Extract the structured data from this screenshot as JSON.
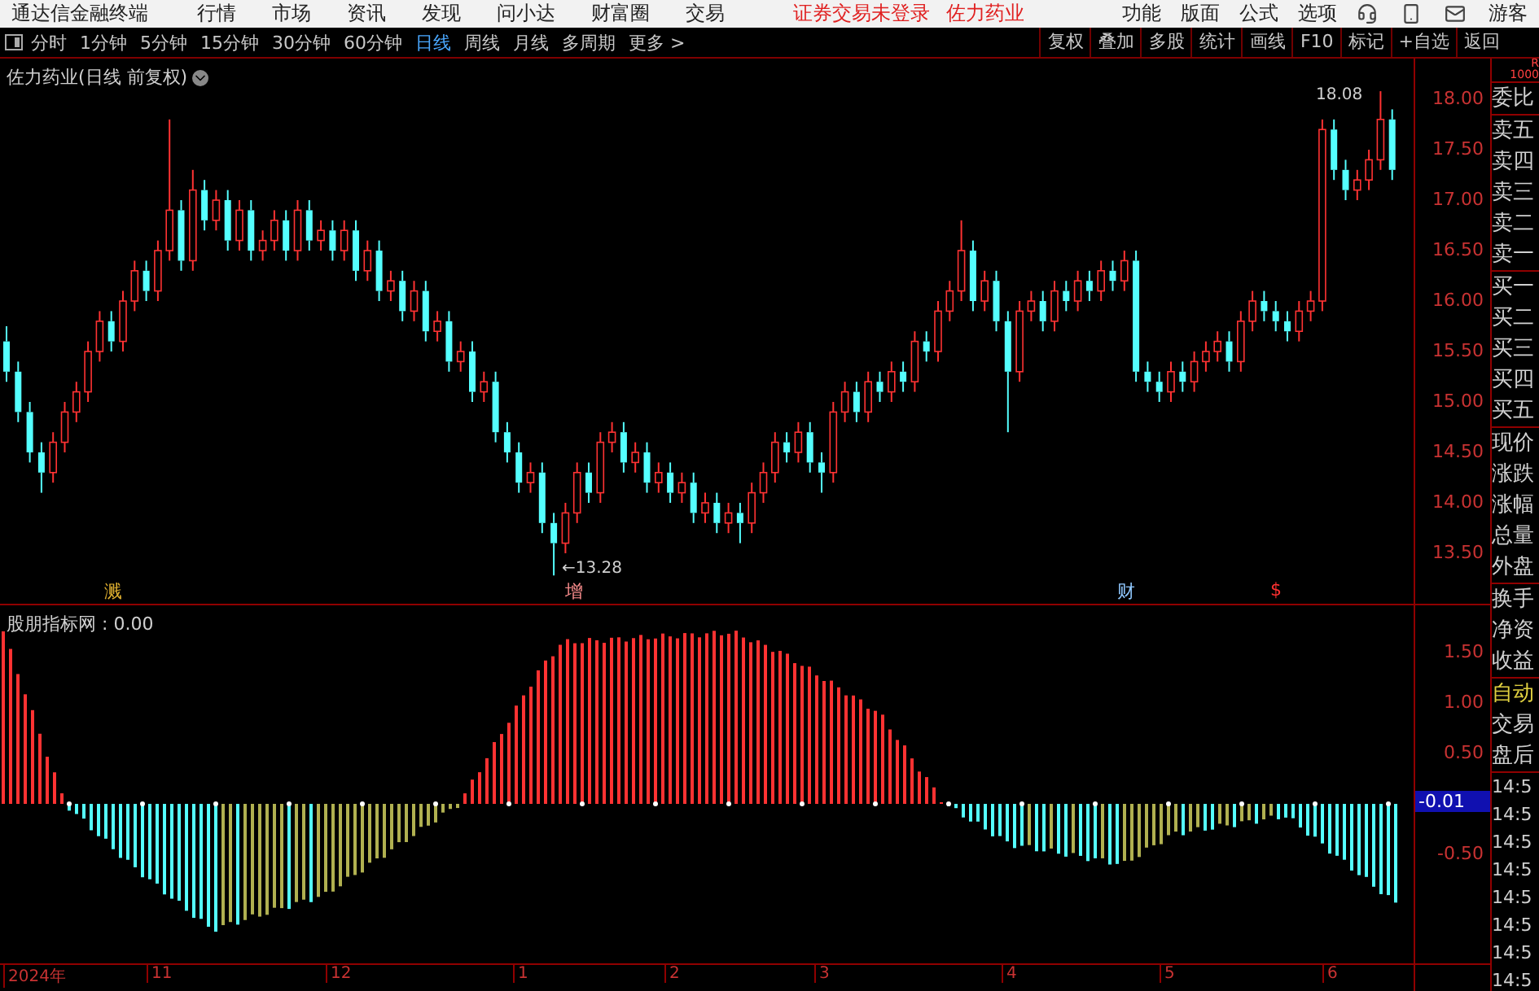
{
  "app": {
    "title": "通达信金融终端",
    "menus": [
      "行情",
      "市场",
      "资讯",
      "发现",
      "问小达",
      "财富圈",
      "交易"
    ],
    "notice": "证券交易未登录",
    "stock": "佐力药业",
    "right_menus": [
      "功能",
      "版面",
      "公式",
      "选项"
    ],
    "user": "游客"
  },
  "periods": [
    {
      "label": "分时",
      "selected": false
    },
    {
      "label": "1分钟",
      "selected": false
    },
    {
      "label": "5分钟",
      "selected": false
    },
    {
      "label": "15分钟",
      "selected": false
    },
    {
      "label": "30分钟",
      "selected": false
    },
    {
      "label": "60分钟",
      "selected": false
    },
    {
      "label": "日线",
      "selected": true
    },
    {
      "label": "周线",
      "selected": false
    },
    {
      "label": "月线",
      "selected": false
    },
    {
      "label": "多周期",
      "selected": false
    },
    {
      "label": "更多 >",
      "selected": false
    }
  ],
  "tools": [
    "复权",
    "叠加",
    "多股",
    "统计",
    "画线",
    "F10",
    "标记",
    "+自选",
    "返回"
  ],
  "price_chart": {
    "title": "佐力药业(日线 前复权)",
    "chart_data": {
      "type": "candlestick",
      "ohlc": [
        [
          15.6,
          15.75,
          15.2,
          15.3
        ],
        [
          15.3,
          15.4,
          14.8,
          14.9
        ],
        [
          14.9,
          15.0,
          14.4,
          14.5
        ],
        [
          14.5,
          14.6,
          14.1,
          14.3
        ],
        [
          14.3,
          14.7,
          14.2,
          14.6
        ],
        [
          14.6,
          15.0,
          14.5,
          14.9
        ],
        [
          14.9,
          15.2,
          14.8,
          15.1
        ],
        [
          15.1,
          15.6,
          15.0,
          15.5
        ],
        [
          15.5,
          15.9,
          15.4,
          15.8
        ],
        [
          15.8,
          15.9,
          15.5,
          15.6
        ],
        [
          15.6,
          16.1,
          15.5,
          16.0
        ],
        [
          16.0,
          16.4,
          15.9,
          16.3
        ],
        [
          16.3,
          16.4,
          16.0,
          16.1
        ],
        [
          16.1,
          16.6,
          16.0,
          16.5
        ],
        [
          16.5,
          17.8,
          16.4,
          16.9
        ],
        [
          16.9,
          17.0,
          16.3,
          16.4
        ],
        [
          16.4,
          17.3,
          16.3,
          17.1
        ],
        [
          17.1,
          17.2,
          16.7,
          16.8
        ],
        [
          16.8,
          17.1,
          16.7,
          17.0
        ],
        [
          17.0,
          17.1,
          16.5,
          16.6
        ],
        [
          16.6,
          17.0,
          16.5,
          16.9
        ],
        [
          16.9,
          17.0,
          16.4,
          16.5
        ],
        [
          16.5,
          16.7,
          16.4,
          16.6
        ],
        [
          16.6,
          16.9,
          16.5,
          16.8
        ],
        [
          16.8,
          16.9,
          16.4,
          16.5
        ],
        [
          16.5,
          17.0,
          16.4,
          16.9
        ],
        [
          16.9,
          17.0,
          16.5,
          16.6
        ],
        [
          16.6,
          16.8,
          16.5,
          16.7
        ],
        [
          16.7,
          16.8,
          16.4,
          16.5
        ],
        [
          16.5,
          16.8,
          16.4,
          16.7
        ],
        [
          16.7,
          16.8,
          16.2,
          16.3
        ],
        [
          16.3,
          16.6,
          16.2,
          16.5
        ],
        [
          16.5,
          16.6,
          16.0,
          16.1
        ],
        [
          16.1,
          16.3,
          16.0,
          16.2
        ],
        [
          16.2,
          16.3,
          15.8,
          15.9
        ],
        [
          15.9,
          16.2,
          15.8,
          16.1
        ],
        [
          16.1,
          16.2,
          15.6,
          15.7
        ],
        [
          15.7,
          15.9,
          15.6,
          15.8
        ],
        [
          15.8,
          15.9,
          15.3,
          15.4
        ],
        [
          15.4,
          15.6,
          15.3,
          15.5
        ],
        [
          15.5,
          15.6,
          15.0,
          15.1
        ],
        [
          15.1,
          15.3,
          15.0,
          15.2
        ],
        [
          15.2,
          15.3,
          14.6,
          14.7
        ],
        [
          14.7,
          14.8,
          14.4,
          14.5
        ],
        [
          14.5,
          14.6,
          14.1,
          14.2
        ],
        [
          14.2,
          14.4,
          14.1,
          14.3
        ],
        [
          14.3,
          14.4,
          13.7,
          13.8
        ],
        [
          13.8,
          13.9,
          13.28,
          13.6
        ],
        [
          13.6,
          14.0,
          13.5,
          13.9
        ],
        [
          13.9,
          14.4,
          13.8,
          14.3
        ],
        [
          14.3,
          14.4,
          14.0,
          14.1
        ],
        [
          14.1,
          14.7,
          14.0,
          14.6
        ],
        [
          14.6,
          14.8,
          14.5,
          14.7
        ],
        [
          14.7,
          14.8,
          14.3,
          14.4
        ],
        [
          14.4,
          14.6,
          14.3,
          14.5
        ],
        [
          14.5,
          14.6,
          14.1,
          14.2
        ],
        [
          14.2,
          14.4,
          14.1,
          14.3
        ],
        [
          14.3,
          14.4,
          14.0,
          14.1
        ],
        [
          14.1,
          14.3,
          14.0,
          14.2
        ],
        [
          14.2,
          14.3,
          13.8,
          13.9
        ],
        [
          13.9,
          14.1,
          13.8,
          14.0
        ],
        [
          14.0,
          14.1,
          13.7,
          13.8
        ],
        [
          13.8,
          14.0,
          13.7,
          13.9
        ],
        [
          13.9,
          14.0,
          13.6,
          13.8
        ],
        [
          13.8,
          14.2,
          13.7,
          14.1
        ],
        [
          14.1,
          14.4,
          14.0,
          14.3
        ],
        [
          14.3,
          14.7,
          14.2,
          14.6
        ],
        [
          14.6,
          14.7,
          14.4,
          14.5
        ],
        [
          14.5,
          14.8,
          14.4,
          14.7
        ],
        [
          14.7,
          14.8,
          14.3,
          14.4
        ],
        [
          14.4,
          14.5,
          14.1,
          14.3
        ],
        [
          14.3,
          15.0,
          14.2,
          14.9
        ],
        [
          14.9,
          15.2,
          14.8,
          15.1
        ],
        [
          15.1,
          15.2,
          14.8,
          14.9
        ],
        [
          14.9,
          15.3,
          14.8,
          15.2
        ],
        [
          15.2,
          15.3,
          15.0,
          15.1
        ],
        [
          15.1,
          15.4,
          15.0,
          15.3
        ],
        [
          15.3,
          15.4,
          15.1,
          15.2
        ],
        [
          15.2,
          15.7,
          15.1,
          15.6
        ],
        [
          15.6,
          15.7,
          15.4,
          15.5
        ],
        [
          15.5,
          16.0,
          15.4,
          15.9
        ],
        [
          15.9,
          16.2,
          15.8,
          16.1
        ],
        [
          16.1,
          16.8,
          16.0,
          16.5
        ],
        [
          16.5,
          16.6,
          15.9,
          16.0
        ],
        [
          16.0,
          16.3,
          15.9,
          16.2
        ],
        [
          16.2,
          16.3,
          15.7,
          15.8
        ],
        [
          15.8,
          15.9,
          14.7,
          15.3
        ],
        [
          15.3,
          16.0,
          15.2,
          15.9
        ],
        [
          15.9,
          16.1,
          15.8,
          16.0
        ],
        [
          16.0,
          16.1,
          15.7,
          15.8
        ],
        [
          15.8,
          16.2,
          15.7,
          16.1
        ],
        [
          16.1,
          16.2,
          15.9,
          16.0
        ],
        [
          16.0,
          16.3,
          15.9,
          16.2
        ],
        [
          16.2,
          16.3,
          16.0,
          16.1
        ],
        [
          16.1,
          16.4,
          16.0,
          16.3
        ],
        [
          16.3,
          16.4,
          16.1,
          16.2
        ],
        [
          16.2,
          16.5,
          16.1,
          16.4
        ],
        [
          16.4,
          16.5,
          15.2,
          15.3
        ],
        [
          15.3,
          15.4,
          15.1,
          15.2
        ],
        [
          15.2,
          15.3,
          15.0,
          15.1
        ],
        [
          15.1,
          15.4,
          15.0,
          15.3
        ],
        [
          15.3,
          15.4,
          15.1,
          15.2
        ],
        [
          15.2,
          15.5,
          15.1,
          15.4
        ],
        [
          15.4,
          15.6,
          15.3,
          15.5
        ],
        [
          15.5,
          15.7,
          15.4,
          15.6
        ],
        [
          15.6,
          15.7,
          15.3,
          15.4
        ],
        [
          15.4,
          15.9,
          15.3,
          15.8
        ],
        [
          15.8,
          16.1,
          15.7,
          16.0
        ],
        [
          16.0,
          16.1,
          15.8,
          15.9
        ],
        [
          15.9,
          16.0,
          15.7,
          15.8
        ],
        [
          15.8,
          15.9,
          15.6,
          15.7
        ],
        [
          15.7,
          16.0,
          15.6,
          15.9
        ],
        [
          15.9,
          16.1,
          15.8,
          16.0
        ],
        [
          16.0,
          17.8,
          15.9,
          17.7
        ],
        [
          17.7,
          17.8,
          17.2,
          17.3
        ],
        [
          17.3,
          17.4,
          17.0,
          17.1
        ],
        [
          17.1,
          17.3,
          17.0,
          17.2
        ],
        [
          17.2,
          17.5,
          17.1,
          17.4
        ],
        [
          17.4,
          18.08,
          17.3,
          17.8
        ],
        [
          17.8,
          17.9,
          17.2,
          17.3
        ]
      ]
    },
    "high_label": "18.08",
    "low_label": "←13.28",
    "axis": [
      "18.00",
      "17.50",
      "17.00",
      "16.50",
      "16.00",
      "15.50",
      "15.00",
      "14.50",
      "14.00",
      "13.50"
    ],
    "events": [
      {
        "label": "溅",
        "color": "#e0b030"
      },
      {
        "label": "增",
        "color": "#ff9090"
      },
      {
        "label": "财",
        "color": "#90c8ff"
      },
      {
        "label": "$",
        "color": "#ff3030"
      }
    ]
  },
  "indicator": {
    "title": "股朋指标网 : 0.00",
    "axis": [
      "1.50",
      "1.00",
      "0.50",
      "-0.50"
    ],
    "current": "-0.01"
  },
  "dates": [
    "2024年",
    "11",
    "12",
    "1",
    "2",
    "3",
    "4",
    "5",
    "6"
  ],
  "quote_header": [
    "R",
    "1000"
  ],
  "side_panel": [
    [
      "委比"
    ],
    [
      "卖五",
      "卖四",
      "卖三",
      "卖二",
      "卖一"
    ],
    [
      "买一",
      "买二",
      "买三",
      "买四",
      "买五"
    ],
    [
      "现价",
      "涨跌",
      "涨幅",
      "总量",
      "外盘"
    ],
    [
      "换手",
      "净资",
      "收益"
    ]
  ],
  "modes": [
    {
      "label": "自动",
      "selected": true
    },
    {
      "label": "交易",
      "selected": false
    },
    {
      "label": "盘后",
      "selected": false
    }
  ],
  "ticks": [
    "14:5",
    "14:5",
    "14:5",
    "14:5",
    "14:5",
    "14:5",
    "14:5",
    "14:5"
  ]
}
